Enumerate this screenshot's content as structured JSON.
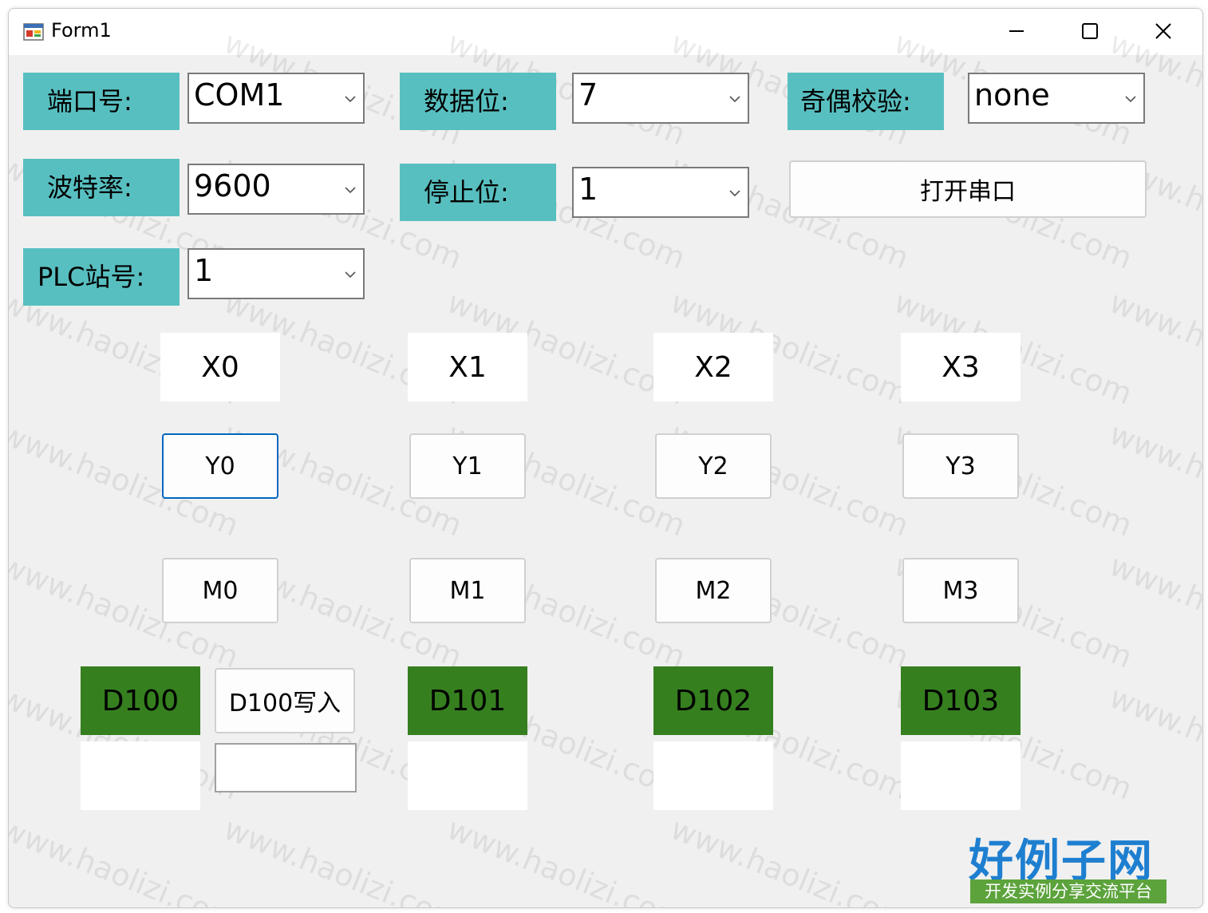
{
  "window": {
    "title": "Form1"
  },
  "settings": {
    "port_label": "端口号:",
    "port_value": "COM1",
    "databits_label": "数据位:",
    "databits_value": "7",
    "parity_label": "奇偶校验:",
    "parity_value": "none",
    "baud_label": "波特率:",
    "baud_value": "9600",
    "stopbits_label": "停止位:",
    "stopbits_value": "1",
    "station_label": "PLC站号:",
    "station_value": "1",
    "open_port_label": "打开串口"
  },
  "inputs_x": [
    "X0",
    "X1",
    "X2",
    "X3"
  ],
  "outputs_y": [
    "Y0",
    "Y1",
    "Y2",
    "Y3"
  ],
  "relays_m": [
    "M0",
    "M1",
    "M2",
    "M3"
  ],
  "registers": {
    "labels": [
      "D100",
      "D101",
      "D102",
      "D103"
    ],
    "write_button": "D100写入",
    "write_value": ""
  },
  "watermark": "www.haolizi.com",
  "logo": {
    "title": "好例子网",
    "subtitle": "开发实例分享交流平台"
  },
  "colors": {
    "label_bg": "#58bfc0",
    "register_bg": "#357f1f",
    "focus_border": "#0067c0",
    "window_bg": "#f0f0f0"
  }
}
